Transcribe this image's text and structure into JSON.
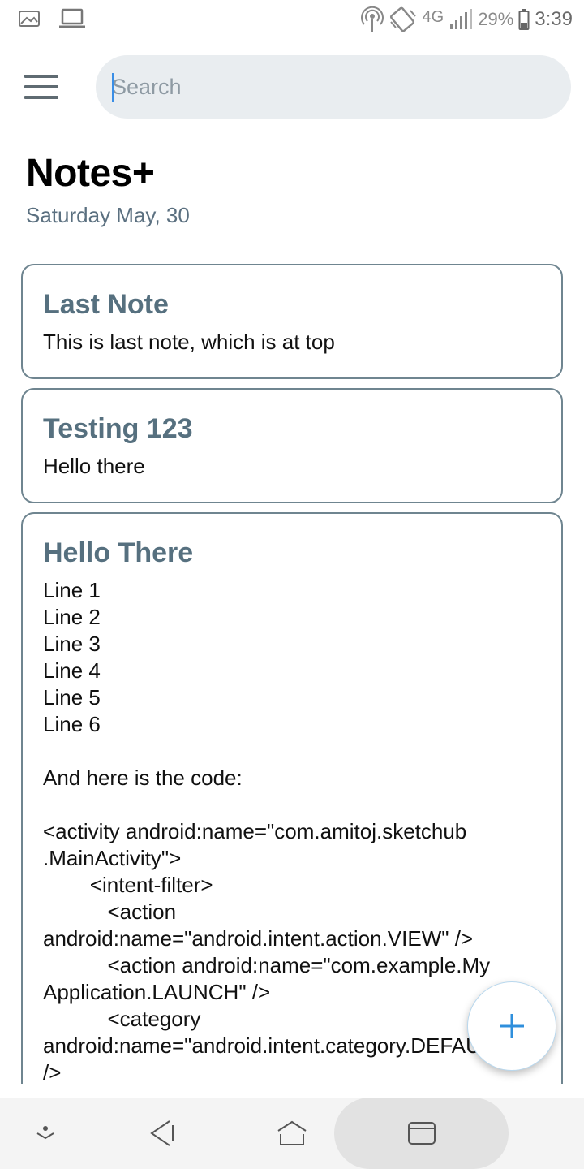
{
  "status_bar": {
    "network": "4G",
    "battery": "29%",
    "time": "3:39",
    "icons": [
      "gallery-icon",
      "laptop-icon",
      "hotspot-icon",
      "rotate-icon",
      "signal-icon",
      "battery-icon"
    ]
  },
  "header": {
    "search_placeholder": "Search",
    "title": "Notes+",
    "date": "Saturday May, 30"
  },
  "notes": [
    {
      "title": "Last Note",
      "body": "This is last note, which is at top"
    },
    {
      "title": "Testing 123",
      "body": "Hello there"
    },
    {
      "title": "Hello There",
      "body": "Line 1\nLine 2\nLine 3\nLine 4\nLine 5\nLine 6\n\nAnd here is the code:\n\n<activity android:name=\"com.amitoj.sketchub\n.MainActivity\">\n        <intent-filter>\n           <action\nandroid:name=\"android.intent.action.VIEW\" />\n           <action android:name=\"com.example.My\nApplication.LAUNCH\" />\n           <category\nandroid:name=\"android.intent.category.DEFAULT\"\n/>"
    }
  ],
  "colors": {
    "accent": "#2f8fdc",
    "title_text": "#56707f",
    "card_border": "#6f8590",
    "search_bg": "#e9edf0"
  },
  "fab": {
    "icon": "plus-icon"
  },
  "nav_bar": {
    "icons": [
      "chevron-down-icon",
      "back-icon",
      "home-icon",
      "recents-icon"
    ]
  }
}
